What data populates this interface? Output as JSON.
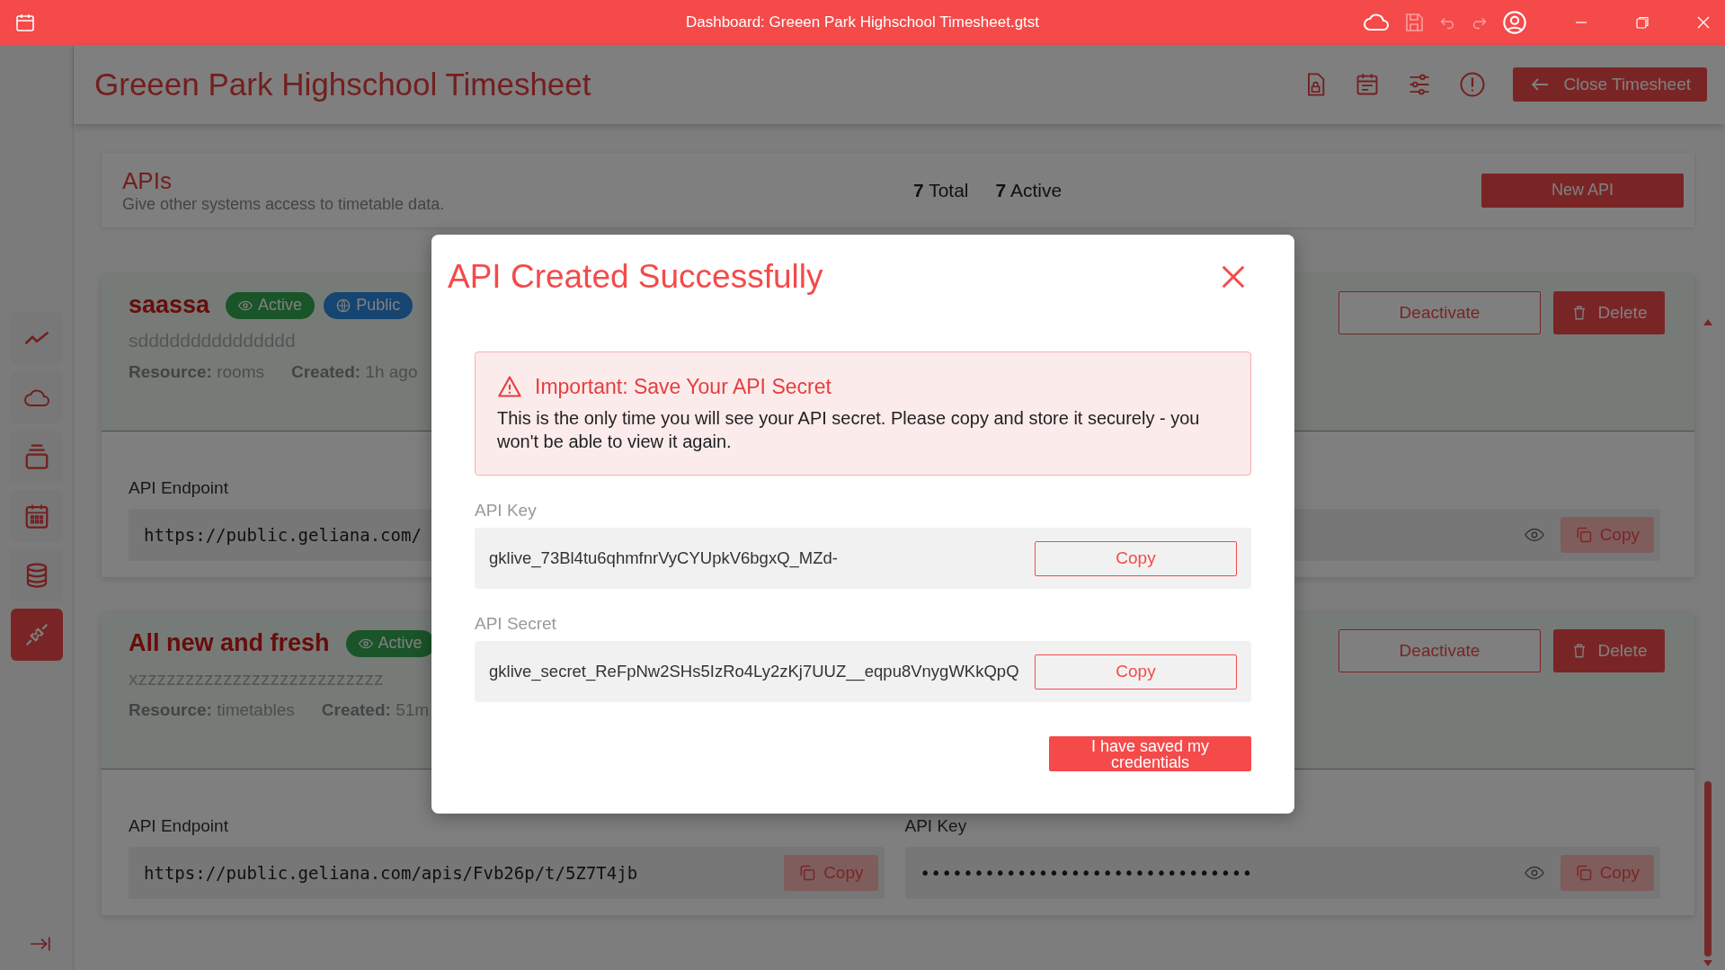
{
  "title_bar": {
    "title": "Dashboard: Greeen Park Highschool Timesheet.gtst"
  },
  "sidebar": {
    "items": [
      {
        "kind": "chart",
        "selected": false
      },
      {
        "kind": "cloud",
        "selected": false
      },
      {
        "kind": "layers",
        "selected": false
      },
      {
        "kind": "calendar",
        "selected": false
      },
      {
        "kind": "database",
        "selected": false
      },
      {
        "kind": "plug",
        "selected": true
      }
    ]
  },
  "header": {
    "title": "Greeen Park Highschool Timesheet",
    "close_button": "Close Timesheet"
  },
  "apis_panel": {
    "title": "APIs",
    "subtitle": "Give other systems access to timetable data.",
    "total_count": "7",
    "total_label": "Total",
    "active_count": "7",
    "active_label": "Active",
    "new_button": "New API"
  },
  "api_cards": [
    {
      "name": "saassa",
      "badges": [
        {
          "kind": "active",
          "label": "Active"
        },
        {
          "kind": "public",
          "label": "Public"
        }
      ],
      "description": "sddddddddddddddd",
      "resource_label": "Resource:",
      "resource": "rooms",
      "created_label": "Created:",
      "created": "1h ago",
      "deactivate_button": "Deactivate",
      "delete_button": "Delete",
      "endpoint_label": "API Endpoint",
      "endpoint": "https://public.geliana.com/",
      "key_copy": "Copy"
    },
    {
      "name": "All new and fresh",
      "badges": [
        {
          "kind": "active",
          "label": "Active"
        }
      ],
      "description": "xzzzzzzzzzzzzzzzzzzzzzzzzzz",
      "resource_label": "Resource:",
      "resource": "timetables",
      "created_label": "Created:",
      "created": "51m",
      "deactivate_button": "Deactivate",
      "delete_button": "Delete",
      "endpoint_label": "API Endpoint",
      "endpoint": "https://public.geliana.com/apis/Fvb26p/t/5Z7T4jb",
      "endpoint_copy": "Copy",
      "key_label": "API Key",
      "key": "•••••••••••••••••••••••••••••••",
      "key_copy": "Copy"
    }
  ],
  "modal": {
    "title": "API Created Successfully",
    "warning_title": "Important: Save Your API Secret",
    "warning_text": "This is the only time you will see your API secret. Please copy and store it securely - you won't be able to view it again.",
    "fields": [
      {
        "label": "API Key",
        "value": "gklive_73Bl4tu6qhmfnrVyCYUpkV6bgxQ_MZd-",
        "copy": "Copy"
      },
      {
        "label": "API Secret",
        "value": "gklive_secret_ReFpNw2SHs5IzRo4Ly2zKj7UUZ__eqpu8VnygWKkQpQ",
        "copy": "Copy"
      }
    ],
    "confirm_button": "I have saved my credentials"
  }
}
